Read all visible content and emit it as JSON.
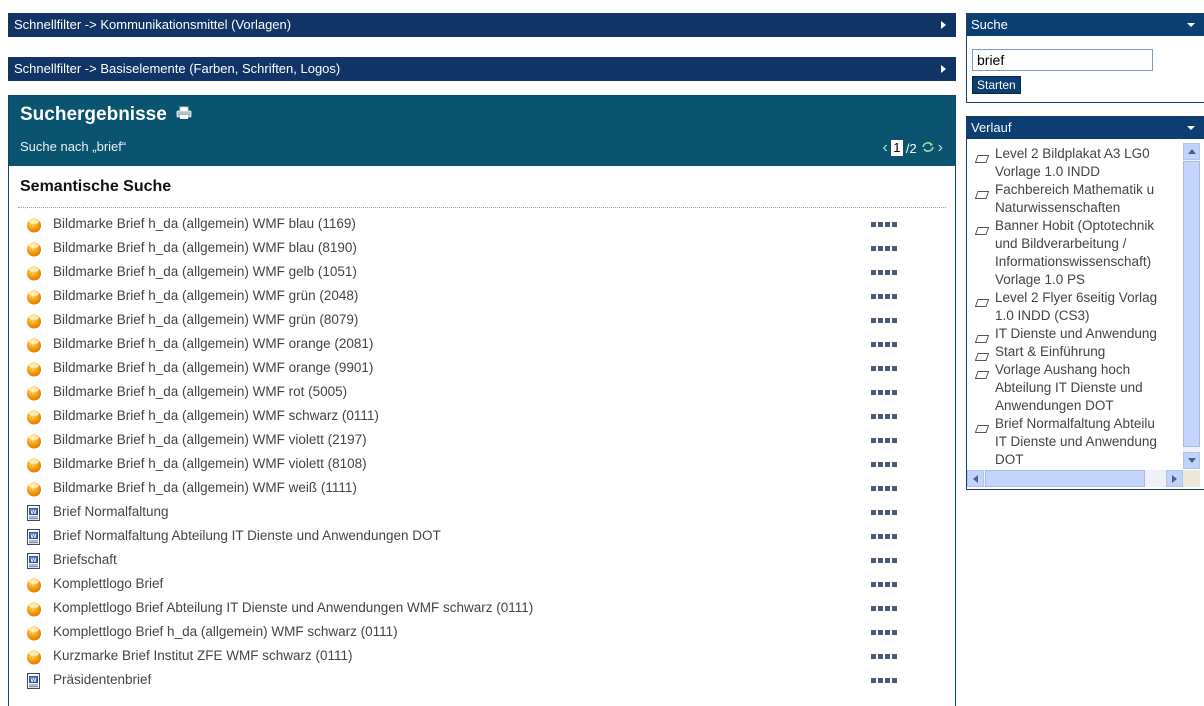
{
  "quickfilters": [
    {
      "label": "Schnellfilter -> Kommunikationsmittel (Vorlagen)"
    },
    {
      "label": "Schnellfilter -> Basiselemente (Farben, Schriften, Logos)"
    }
  ],
  "results": {
    "title": "Suchergebnisse",
    "query_text": "Suche nach „brief“",
    "pager": {
      "current": "1",
      "total": "/2",
      "prev_icon": "chevron-left-icon",
      "next_icon": "chevron-right-icon"
    },
    "section_title": "Semantische Suche",
    "items": [
      {
        "label": "Bildmarke Brief h_da (allgemein) WMF blau (1169)",
        "icon": "orange-dot-icon",
        "rating": 4
      },
      {
        "label": "Bildmarke Brief h_da (allgemein) WMF blau (8190)",
        "icon": "orange-dot-icon",
        "rating": 4
      },
      {
        "label": "Bildmarke Brief h_da (allgemein) WMF gelb (1051)",
        "icon": "orange-dot-icon",
        "rating": 4
      },
      {
        "label": "Bildmarke Brief h_da (allgemein) WMF grün (2048)",
        "icon": "orange-dot-icon",
        "rating": 4
      },
      {
        "label": "Bildmarke Brief h_da (allgemein) WMF grün (8079)",
        "icon": "orange-dot-icon",
        "rating": 4
      },
      {
        "label": "Bildmarke Brief h_da (allgemein) WMF orange (2081)",
        "icon": "orange-dot-icon",
        "rating": 4
      },
      {
        "label": "Bildmarke Brief h_da (allgemein) WMF orange (9901)",
        "icon": "orange-dot-icon",
        "rating": 4
      },
      {
        "label": "Bildmarke Brief h_da (allgemein) WMF rot (5005)",
        "icon": "orange-dot-icon",
        "rating": 4
      },
      {
        "label": "Bildmarke Brief h_da (allgemein) WMF schwarz (0111)",
        "icon": "orange-dot-icon",
        "rating": 4
      },
      {
        "label": "Bildmarke Brief h_da (allgemein) WMF violett (2197)",
        "icon": "orange-dot-icon",
        "rating": 4
      },
      {
        "label": "Bildmarke Brief h_da (allgemein) WMF violett (8108)",
        "icon": "orange-dot-icon",
        "rating": 4
      },
      {
        "label": "Bildmarke Brief h_da (allgemein) WMF weiß (1111)",
        "icon": "orange-dot-icon",
        "rating": 4
      },
      {
        "label": "Brief Normalfaltung",
        "icon": "word-document-icon",
        "rating": 4
      },
      {
        "label": "Brief Normalfaltung Abteilung IT Dienste und Anwendungen DOT",
        "icon": "word-document-icon",
        "rating": 4
      },
      {
        "label": "Briefschaft",
        "icon": "word-document-icon",
        "rating": 4
      },
      {
        "label": "Komplettlogo Brief",
        "icon": "orange-dot-icon",
        "rating": 4
      },
      {
        "label": "Komplettlogo Brief Abteilung IT Dienste und Anwendungen WMF schwarz (0111)",
        "icon": "orange-dot-icon",
        "rating": 4
      },
      {
        "label": "Komplettlogo Brief h_da (allgemein) WMF schwarz (0111)",
        "icon": "orange-dot-icon",
        "rating": 4
      },
      {
        "label": "Kurzmarke Brief Institut ZFE WMF schwarz (0111)",
        "icon": "orange-dot-icon",
        "rating": 4
      },
      {
        "label": "Präsidentenbrief",
        "icon": "word-document-icon",
        "rating": 4
      }
    ]
  },
  "search_panel": {
    "title": "Suche",
    "query_value": "brief",
    "start_label": "Starten"
  },
  "history_panel": {
    "title": "Verlauf",
    "items": [
      {
        "lines": [
          "Level 2 Bildplakat A3 LG0",
          "Vorlage 1.0 INDD"
        ]
      },
      {
        "lines": [
          "Fachbereich Mathematik u",
          "Naturwissenschaften"
        ]
      },
      {
        "lines": [
          "Banner Hobit (Optotechnik",
          "und Bildverarbeitung /",
          "Informationswissenschaft)",
          "Vorlage 1.0 PS"
        ]
      },
      {
        "lines": [
          "Level 2 Flyer 6seitig Vorlag",
          "1.0 INDD (CS3)"
        ]
      },
      {
        "lines": [
          "IT Dienste und Anwendung"
        ]
      },
      {
        "lines": [
          "Start & Einführung"
        ]
      },
      {
        "lines": [
          "Vorlage Aushang hoch",
          "Abteilung IT Dienste und",
          "Anwendungen DOT"
        ]
      },
      {
        "lines": [
          "Brief Normalfaltung Abteilu",
          "IT Dienste und Anwendung",
          "DOT"
        ]
      }
    ]
  },
  "colors": {
    "nav_bar": "#113366",
    "results_header": "#0b5470",
    "side_header": "#0b3f72",
    "orange_icon": "#f5a623"
  }
}
